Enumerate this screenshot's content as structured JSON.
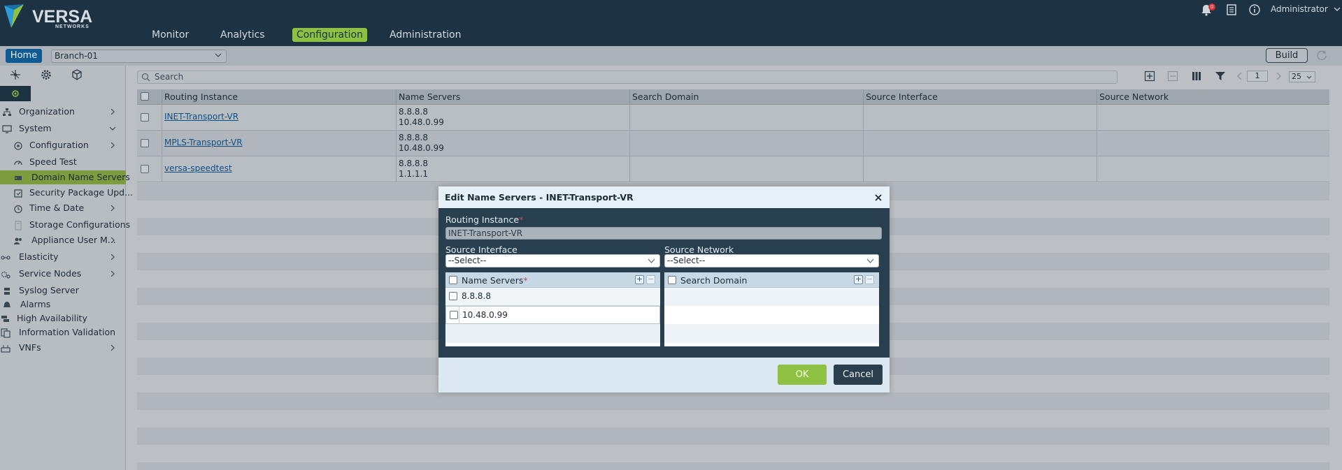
{
  "brand": {
    "name": "VERSA",
    "sub": "NETWORKS"
  },
  "nav": [
    {
      "label": "Monitor"
    },
    {
      "label": "Analytics"
    },
    {
      "label": "Configuration"
    },
    {
      "label": "Administration"
    }
  ],
  "topright": {
    "user": "Administrator",
    "notification_count": "0"
  },
  "subbar": {
    "home": "Home",
    "device": "Branch-01",
    "build": "Build"
  },
  "sidebar": {
    "items": [
      {
        "label": "Organization"
      },
      {
        "label": "System"
      },
      {
        "label": "Configuration"
      },
      {
        "label": "Speed Test"
      },
      {
        "label": "Domain Name Servers"
      },
      {
        "label": "Security Package Upd..."
      },
      {
        "label": "Time & Date"
      },
      {
        "label": "Storage Configurations"
      },
      {
        "label": "Appliance User M..."
      },
      {
        "label": "Elasticity"
      },
      {
        "label": "Service Nodes"
      },
      {
        "label": "Syslog Server"
      },
      {
        "label": "Alarms"
      },
      {
        "label": "High Availability"
      },
      {
        "label": "Information Validation"
      },
      {
        "label": "VNFs"
      }
    ]
  },
  "search": {
    "placeholder": "Search"
  },
  "pager": {
    "page": "1",
    "per_page": "25"
  },
  "table": {
    "headers": [
      "Routing Instance",
      "Name Servers",
      "Search Domain",
      "Source Interface",
      "Source Network"
    ],
    "rows": [
      {
        "routing_instance": "INET-Transport-VR",
        "ns1": "8.8.8.8",
        "ns2": "10.48.0.99"
      },
      {
        "routing_instance": "MPLS-Transport-VR",
        "ns1": "8.8.8.8",
        "ns2": "10.48.0.99"
      },
      {
        "routing_instance": "versa-speedtest",
        "ns1": "8.8.8.8",
        "ns2": "1.1.1.1"
      }
    ]
  },
  "modal": {
    "title": "Edit Name Servers - INET-Transport-VR",
    "routing_instance_label": "Routing Instance",
    "routing_instance_value": "INET-Transport-VR",
    "source_interface_label": "Source Interface",
    "source_interface_value": "--Select--",
    "source_network_label": "Source Network",
    "source_network_value": "--Select--",
    "name_servers_header": "Name Servers",
    "name_servers": [
      "8.8.8.8",
      "10.48.0.99"
    ],
    "search_domain_header": "Search Domain",
    "ok": "OK",
    "cancel": "Cancel",
    "required_mark": "*"
  }
}
